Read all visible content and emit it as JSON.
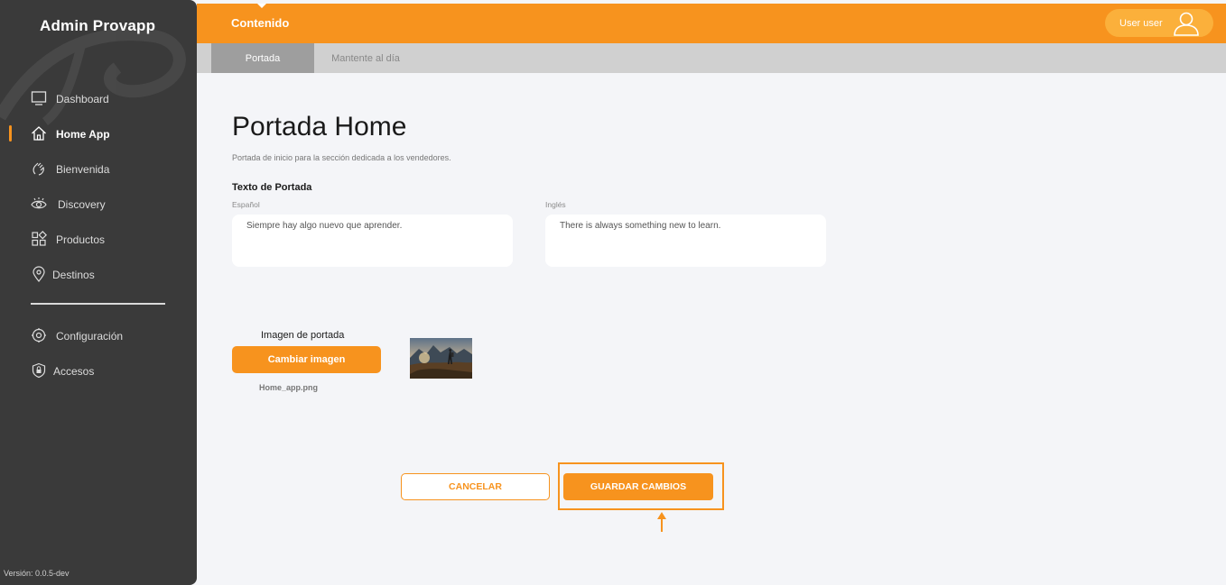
{
  "sidebar": {
    "brand": "Admin Provapp",
    "items": [
      {
        "label": "Dashboard",
        "icon": "monitor-icon"
      },
      {
        "label": "Home App",
        "icon": "home-icon",
        "active": true
      },
      {
        "label": "Bienvenida",
        "icon": "wave-hand-icon"
      },
      {
        "label": "Discovery",
        "icon": "eye-icon"
      },
      {
        "label": "Productos",
        "icon": "grid-icon"
      },
      {
        "label": "Destinos",
        "icon": "location-pin-icon"
      }
    ],
    "secondary": [
      {
        "label": "Configuración",
        "icon": "gear-icon"
      },
      {
        "label": "Accesos",
        "icon": "lock-icon"
      }
    ],
    "version": "Versión: 0.0.5-dev"
  },
  "topbar": {
    "title": "Contenido",
    "user": "User user"
  },
  "tabs": [
    {
      "label": "Portada",
      "active": true
    },
    {
      "label": "Mantente al día",
      "active": false
    }
  ],
  "main": {
    "title": "Portada Home",
    "subtitle": "Portada de inicio para la sección dedicada a los vendedores.",
    "section_label": "Texto de Portada",
    "spanish_label": "Español",
    "spanish_value": "Siempre hay algo nuevo que aprender.",
    "english_label": "Inglés",
    "english_value": "There is always something new to learn.",
    "image_label": "Imagen de portada",
    "change_image": "Cambiar imagen",
    "filename": "Home_app.png",
    "cancel": "CANCELAR",
    "save": "GUARDAR CAMBIOS"
  },
  "colors": {
    "accent": "#f7931e",
    "sidebar": "#3a3a3a",
    "background": "#f4f5f8"
  }
}
